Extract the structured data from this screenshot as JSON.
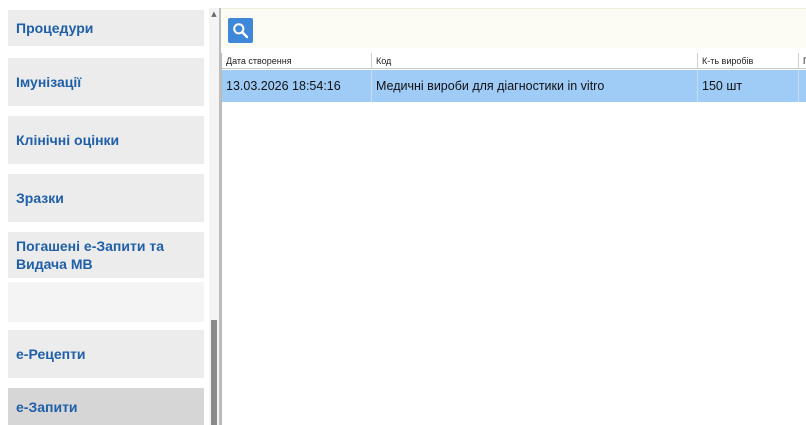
{
  "sidebar": {
    "items": [
      {
        "label": "Процедури"
      },
      {
        "label": "Імунізації"
      },
      {
        "label": "Клінічні оцінки"
      },
      {
        "label": "Зразки"
      },
      {
        "label": "Погашені е-Запити та Видача МВ"
      },
      {
        "label": "е-Рецепти"
      },
      {
        "label": "е-Запити",
        "active": true
      }
    ],
    "scroll_up_glyph": "▲"
  },
  "toolbar": {
    "search_icon": "search-icon",
    "accent": "#3f87d8"
  },
  "grid": {
    "columns": [
      "Дата створення",
      "Код",
      "К-ть виробів",
      "П"
    ],
    "rows": [
      {
        "created": "13.03.2026 18:54:16",
        "code": "Медичні вироби для діагностики in vitro",
        "quantity": "150 шт",
        "extra": ""
      }
    ],
    "selected_row_color": "#9fcbf7"
  }
}
